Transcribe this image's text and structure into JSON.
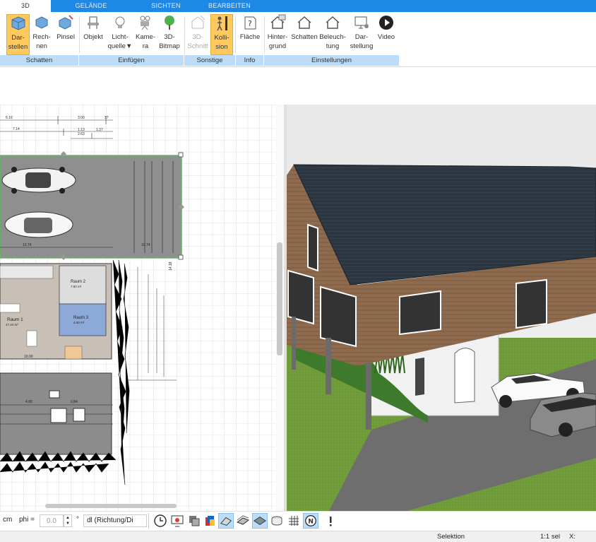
{
  "tabs": [
    "3D",
    "GELÄNDE",
    "SICHTEN",
    "BEARBEITEN"
  ],
  "ribbon": {
    "buttons": [
      {
        "label1": "Dar-",
        "label2": "stellen"
      },
      {
        "label1": "Rech-",
        "label2": "nen"
      },
      {
        "label1": "Pinsel",
        "label2": ""
      },
      {
        "label1": "Objekt",
        "label2": ""
      },
      {
        "label1": "Licht-",
        "label2": "quelle"
      },
      {
        "label1": "Kame-",
        "label2": "ra"
      },
      {
        "label1": "3D-",
        "label2": "Bitmap"
      },
      {
        "label1": "3D-",
        "label2": "Schnitt"
      },
      {
        "label1": "Kolli-",
        "label2": "sion"
      },
      {
        "label1": "Fläche",
        "label2": ""
      },
      {
        "label1": "Hinter-",
        "label2": "grund"
      },
      {
        "label1": "Schatten",
        "label2": ""
      },
      {
        "label1": "Beleuch-",
        "label2": "tung"
      },
      {
        "label1": "Dar-",
        "label2": "stellung"
      },
      {
        "label1": "Video",
        "label2": ""
      }
    ],
    "groups": [
      "Schatten",
      "Einfügen",
      "Sonstige",
      "Info",
      "Einstellungen"
    ]
  },
  "plan": {
    "dims_top": [
      "6.16",
      "3.00",
      "37",
      "7.14",
      "1.13",
      "1.37",
      "2.63"
    ],
    "rooms": [
      {
        "name": "Raum 1",
        "area": "47.44 m²"
      },
      {
        "name": "Raum 2",
        "area": "7.82 m²"
      },
      {
        "name": "Raum 3",
        "area": "4.00 m²"
      }
    ],
    "dims_other": [
      "10.74",
      "10.74",
      "14.18",
      "10.00",
      "4.00",
      "0.84"
    ]
  },
  "statusbar": {
    "unit": "cm",
    "phi_label": "phi =",
    "phi_value": "0.0",
    "degree": "°",
    "dl_select": "dl (Richtung/Di"
  },
  "bottombar": {
    "mode": "Selektion",
    "scale": "1:1 sel",
    "x_label": "X:"
  },
  "colors": {
    "tab_blue": "#1e88e5",
    "group_blue": "#bcdcf7",
    "active_orange": "#ffc960",
    "roof": "#2b3640",
    "wood": "#8a6a4e"
  }
}
